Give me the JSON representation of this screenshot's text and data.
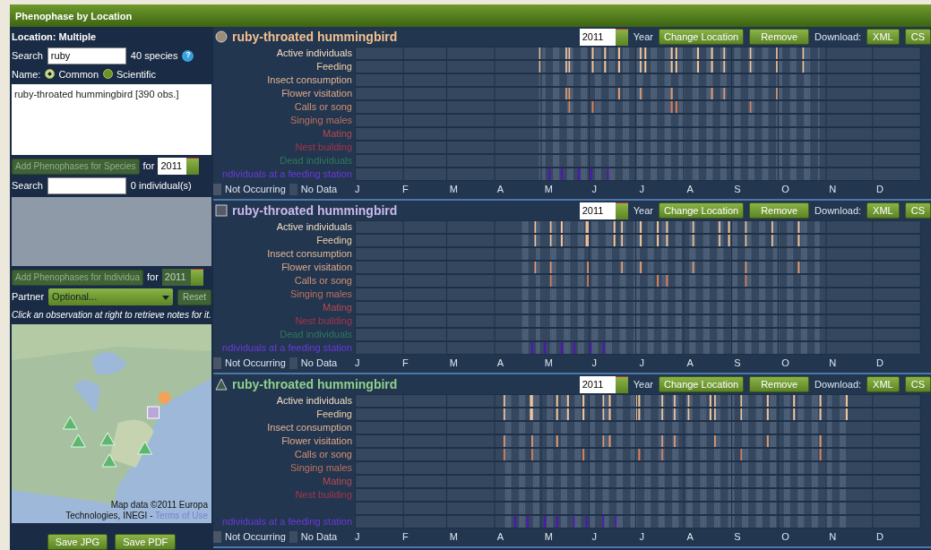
{
  "title": "Phenophase by Location",
  "sidebar": {
    "location_label": "Location: Multiple",
    "species_search": {
      "label": "Search",
      "value": "ruby",
      "count": "40 species",
      "help": "?"
    },
    "name_label": "Name:",
    "name_options": [
      {
        "label": "Common",
        "selected": true
      },
      {
        "label": "Scientific",
        "selected": false
      }
    ],
    "species_list": [
      "ruby-throated hummingbird [390 obs.]"
    ],
    "add_species": {
      "label": "Add Phenophases for Species",
      "disabled": true,
      "for": "for",
      "year": "2011"
    },
    "individual_search": {
      "label": "Search",
      "count": "0 individual(s)"
    },
    "add_individuals": {
      "label": "Add Phenophases for Individua",
      "disabled": true,
      "for": "for",
      "year": "2011"
    },
    "partner": {
      "label": "Partner",
      "value": "Optional...",
      "reset": "Reset",
      "reset_disabled": true
    },
    "hint": "Click an observation at right to retrieve notes for it.",
    "map": {
      "kind": "picture",
      "attribution_1": "Map data ©2011  Europa",
      "attribution_2": "Technologies, INEGI - ",
      "terms_link": "Terms of Use"
    },
    "buttons": [
      "Save JPG",
      "Save PDF"
    ]
  },
  "panels": [
    {
      "marker": {
        "kind": "circle"
      },
      "color": "#f2c08c",
      "title": "ruby-throated hummingbird",
      "year": "2011",
      "year_label": "Year",
      "buttons": [
        "Change Location",
        "Remove"
      ],
      "download_label": "Download:",
      "formats": [
        "XML",
        "CS"
      ],
      "phenophases": [
        {
          "label": "Active individuals",
          "color": "#f3dcc0"
        },
        {
          "label": "Feeding",
          "color": "#f0d0a8"
        },
        {
          "label": "Insect consumption",
          "color": "#e2b494"
        },
        {
          "label": "Flower visitation",
          "color": "#e0a888"
        },
        {
          "label": "Calls or song",
          "color": "#d49274"
        },
        {
          "label": "Singing males",
          "color": "#c0705e"
        },
        {
          "label": "Mating",
          "color": "#b84a4e"
        },
        {
          "label": "Nest building",
          "color": "#a8344a"
        },
        {
          "label": "Dead individuals",
          "color": "#2e7a5c"
        },
        {
          "label": "ndividuals at a feeding station",
          "color": "#6a3ad8"
        }
      ],
      "legend": [
        "Not Occurring",
        "No Data"
      ],
      "months": [
        "J",
        "F",
        "M",
        "A",
        "M",
        "J",
        "J",
        "A",
        "S",
        "O",
        "N",
        "D"
      ]
    },
    {
      "marker": {
        "kind": "square"
      },
      "color": "#c9b9ea",
      "title": "ruby-throated hummingbird",
      "year": "2011",
      "year_label": "Year",
      "buttons": [
        "Change Location",
        "Remove"
      ],
      "download_label": "Download:",
      "formats": [
        "XML",
        "CS"
      ],
      "phenophases": [
        {
          "label": "Active individuals",
          "color": "#f3dcc0"
        },
        {
          "label": "Feeding",
          "color": "#f0d0a8"
        },
        {
          "label": "Insect consumption",
          "color": "#e2b494"
        },
        {
          "label": "Flower visitation",
          "color": "#e0a888"
        },
        {
          "label": "Calls or song",
          "color": "#d49274"
        },
        {
          "label": "Singing males",
          "color": "#c0705e"
        },
        {
          "label": "Mating",
          "color": "#b84a4e"
        },
        {
          "label": "Nest building",
          "color": "#a8344a"
        },
        {
          "label": "Dead individuals",
          "color": "#2e7a5c"
        },
        {
          "label": "ndividuals at a feeding station",
          "color": "#6a3ad8"
        }
      ],
      "legend": [
        "Not Occurring",
        "No Data"
      ],
      "months": [
        "J",
        "F",
        "M",
        "A",
        "M",
        "J",
        "J",
        "A",
        "S",
        "O",
        "N",
        "D"
      ]
    },
    {
      "marker": {
        "kind": "triangle"
      },
      "color": "#8fd08a",
      "title": "ruby-throated hummingbird",
      "year": "2011",
      "year_label": "Year",
      "buttons": [
        "Change Location",
        "Remove"
      ],
      "download_label": "Download:",
      "formats": [
        "XML",
        "CS"
      ],
      "phenophases": [
        {
          "label": "Active individuals",
          "color": "#f3dcc0"
        },
        {
          "label": "Feeding",
          "color": "#f0d0a8"
        },
        {
          "label": "Insect consumption",
          "color": "#e2b494"
        },
        {
          "label": "Flower visitation",
          "color": "#e0a888"
        },
        {
          "label": "Calls or song",
          "color": "#d49274"
        },
        {
          "label": "Singing males",
          "color": "#c0705e"
        },
        {
          "label": "Mating",
          "color": "#b84a4e"
        },
        {
          "label": "Nest building",
          "color": "#a8344a"
        },
        {
          "kind": "blank"
        },
        {
          "label": "ndividuals at a feeding station",
          "color": "#6a3ad8"
        }
      ],
      "legend": [
        "Not Occurring",
        "No Data"
      ],
      "months": [
        "J",
        "F",
        "M",
        "A",
        "M",
        "J",
        "J",
        "A",
        "S",
        "O",
        "N",
        "D"
      ]
    }
  ]
}
